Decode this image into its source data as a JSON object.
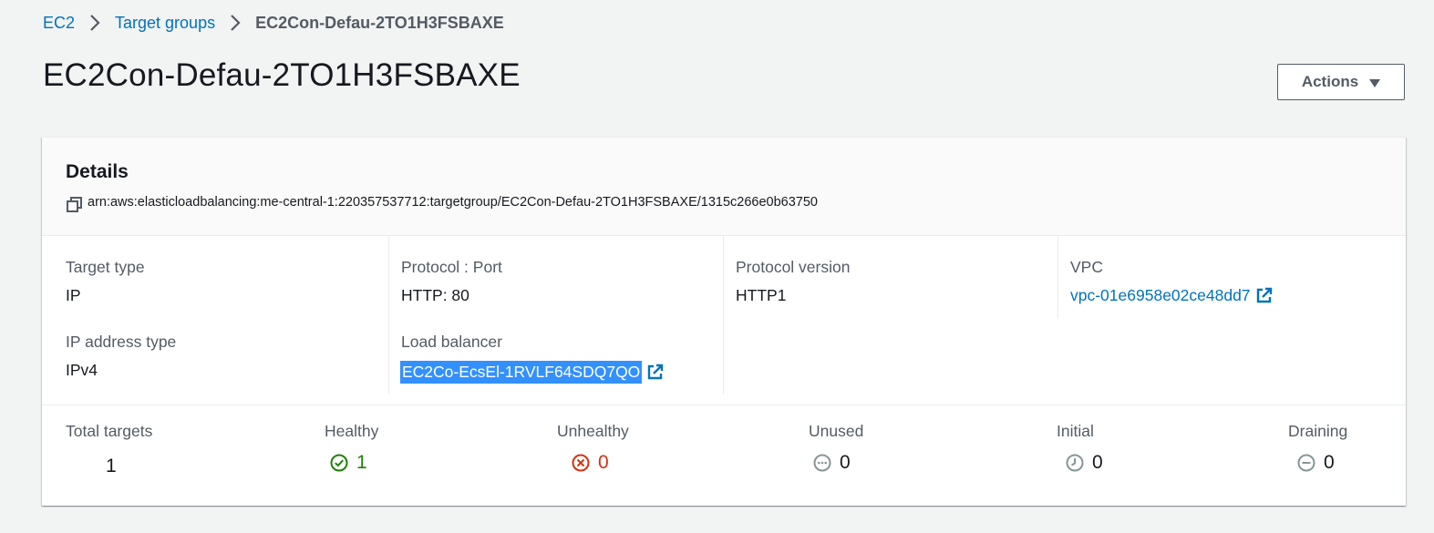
{
  "breadcrumb": {
    "items": [
      "EC2",
      "Target groups"
    ],
    "current": "EC2Con-Defau-2TO1H3FSBAXE"
  },
  "page": {
    "title": "EC2Con-Defau-2TO1H3FSBAXE",
    "actions_label": "Actions"
  },
  "details": {
    "title": "Details",
    "arn": "arn:aws:elasticloadbalancing:me-central-1:220357537712:targetgroup/EC2Con-Defau-2TO1H3FSBAXE/1315c266e0b63750",
    "target_type": {
      "label": "Target type",
      "value": "IP"
    },
    "ip_address_type": {
      "label": "IP address type",
      "value": "IPv4"
    },
    "protocol_port": {
      "label": "Protocol : Port",
      "value": "HTTP: 80"
    },
    "load_balancer": {
      "label": "Load balancer",
      "value": "EC2Co-EcsEl-1RVLF64SDQ7QO"
    },
    "protocol_version": {
      "label": "Protocol version",
      "value": "HTTP1"
    },
    "vpc": {
      "label": "VPC",
      "value": "vpc-01e6958e02ce48dd7"
    }
  },
  "stats": {
    "total": {
      "label": "Total targets",
      "value": "1"
    },
    "healthy": {
      "label": "Healthy",
      "value": "1",
      "icon": "check-circle-icon"
    },
    "unhealthy": {
      "label": "Unhealthy",
      "value": "0",
      "icon": "x-circle-icon"
    },
    "unused": {
      "label": "Unused",
      "value": "0",
      "icon": "ellipsis-circle-icon"
    },
    "initial": {
      "label": "Initial",
      "value": "0",
      "icon": "clock-icon"
    },
    "draining": {
      "label": "Draining",
      "value": "0",
      "icon": "minus-circle-icon"
    }
  },
  "colors": {
    "link": "#0073bb",
    "healthy": "#1d8102",
    "unhealthy": "#d13212",
    "muted": "#879596",
    "selection": "#3390ff"
  }
}
